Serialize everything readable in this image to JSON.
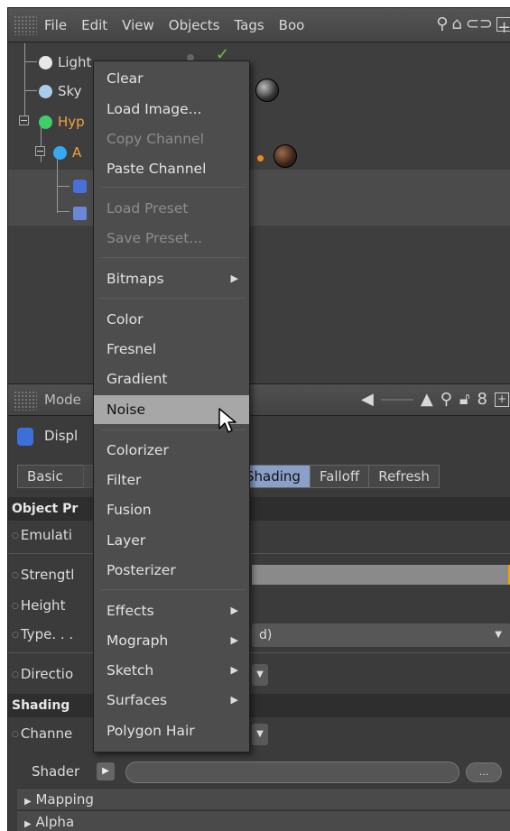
{
  "menubar": {
    "items": [
      "File",
      "Edit",
      "View",
      "Objects",
      "Tags",
      "Boo"
    ],
    "icons": [
      "search-icon",
      "home-icon",
      "orbit-icon",
      "expand-icon"
    ]
  },
  "objects": [
    {
      "name": "Light",
      "icon": "light-icon"
    },
    {
      "name": "Sky",
      "icon": "sky-icon"
    },
    {
      "name": "Hyp",
      "icon": "hypernurbs-icon"
    },
    {
      "name": "A",
      "icon": "sphere-icon"
    }
  ],
  "attributes": {
    "title": "Mode",
    "object_title": "Displ",
    "tabs": [
      "Basic",
      "Shading",
      "Falloff",
      "Refresh"
    ],
    "active_tab": "Shading",
    "sections": {
      "object_properties": "Object Pr",
      "shading": "Shading"
    },
    "properties": {
      "emulation": "Emulati",
      "strength": "Strengtl",
      "height": "Height",
      "type": "Type. . .",
      "type_value": "d)",
      "direction": "Directio",
      "channel": "Channe",
      "shader": "Shader",
      "shader_more": "..."
    },
    "groups": [
      "Mapping",
      "Alpha"
    ]
  },
  "context_menu": {
    "items": [
      {
        "label": "Clear",
        "enabled": true
      },
      {
        "label": "Load Image...",
        "enabled": true
      },
      {
        "label": "Copy Channel",
        "enabled": false
      },
      {
        "label": "Paste Channel",
        "enabled": true
      },
      {
        "label": "Load Preset",
        "enabled": false
      },
      {
        "label": "Save Preset...",
        "enabled": false
      },
      {
        "label": "Bitmaps",
        "enabled": true,
        "submenu": true
      },
      {
        "label": "Color",
        "enabled": true
      },
      {
        "label": "Fresnel",
        "enabled": true
      },
      {
        "label": "Gradient",
        "enabled": true
      },
      {
        "label": "Noise",
        "enabled": true,
        "hovered": true
      },
      {
        "label": "Colorizer",
        "enabled": true
      },
      {
        "label": "Filter",
        "enabled": true
      },
      {
        "label": "Fusion",
        "enabled": true
      },
      {
        "label": "Layer",
        "enabled": true
      },
      {
        "label": "Posterizer",
        "enabled": true
      },
      {
        "label": "Effects",
        "enabled": true,
        "submenu": true
      },
      {
        "label": "Mograph",
        "enabled": true,
        "submenu": true
      },
      {
        "label": "Sketch",
        "enabled": true,
        "submenu": true
      },
      {
        "label": "Surfaces",
        "enabled": true,
        "submenu": true
      },
      {
        "label": "Polygon Hair",
        "enabled": true
      }
    ]
  },
  "colors": {
    "highlight": "#a7a7a7",
    "active_tab": "#8aa0c9",
    "orange_object": "#f3a23a",
    "slider_end": "#f0a000"
  }
}
